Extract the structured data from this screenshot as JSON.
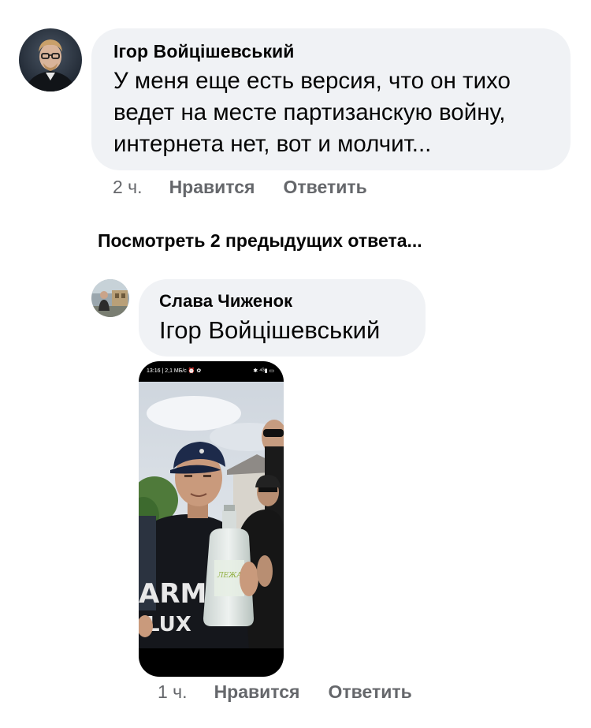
{
  "comment1": {
    "author": "Ігор Войцішевський",
    "text": "У меня еще есть версия, что он тихо ведет на месте партизанскую войну, интернета нет, вот и молчит...",
    "time": "2 ч.",
    "like": "Нравится",
    "reply": "Ответить"
  },
  "view_previous": "Посмотреть 2 предыдущих ответа...",
  "comment2": {
    "author": "Слава Чиженок",
    "mention": "Ігор Войцішевський",
    "photo": {
      "status_left": "13:16 | 2,1 МБ/с ⏰ ✿",
      "status_right": "✱ ⁴ᴳ▮ ▭",
      "shirt_line1": "ARMO",
      "shirt_line2": "LUX",
      "bottle_label": "ЛЕЖАЄ"
    },
    "time": "1 ч.",
    "like": "Нравится",
    "reply": "Ответить"
  },
  "colors": {
    "bubble": "#f0f2f5",
    "meta": "#65676b",
    "text": "#050505"
  },
  "icons": [
    "user-avatar-icon"
  ]
}
